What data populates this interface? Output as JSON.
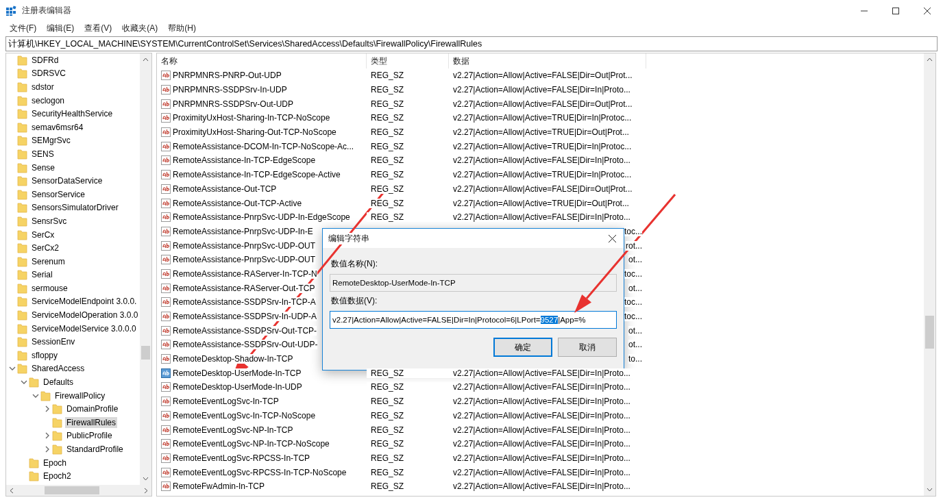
{
  "window": {
    "title": "注册表编辑器"
  },
  "menu": [
    "文件(F)",
    "编辑(E)",
    "查看(V)",
    "收藏夹(A)",
    "帮助(H)"
  ],
  "address": "计算机\\HKEY_LOCAL_MACHINE\\SYSTEM\\CurrentControlSet\\Services\\SharedAccess\\Defaults\\FirewallPolicy\\FirewallRules",
  "tree": {
    "items": [
      {
        "label": "SDFRd",
        "selected": false
      },
      {
        "label": "SDRSVC",
        "selected": false
      },
      {
        "label": "sdstor",
        "selected": false
      },
      {
        "label": "seclogon",
        "selected": false
      },
      {
        "label": "SecurityHealthService",
        "selected": false
      },
      {
        "label": "semav6msr64",
        "selected": false
      },
      {
        "label": "SEMgrSvc",
        "selected": false
      },
      {
        "label": "SENS",
        "selected": false
      },
      {
        "label": "Sense",
        "selected": false
      },
      {
        "label": "SensorDataService",
        "selected": false
      },
      {
        "label": "SensorService",
        "selected": false
      },
      {
        "label": "SensorsSimulatorDriver",
        "selected": false
      },
      {
        "label": "SensrSvc",
        "selected": false
      },
      {
        "label": "SerCx",
        "selected": false
      },
      {
        "label": "SerCx2",
        "selected": false
      },
      {
        "label": "Serenum",
        "selected": false
      },
      {
        "label": "Serial",
        "selected": false
      },
      {
        "label": "sermouse",
        "selected": false
      },
      {
        "label": "ServiceModelEndpoint 3.0.0.",
        "selected": false
      },
      {
        "label": "ServiceModelOperation 3.0.0",
        "selected": false
      },
      {
        "label": "ServiceModelService 3.0.0.0",
        "selected": false
      },
      {
        "label": "SessionEnv",
        "selected": false
      },
      {
        "label": "sfloppy",
        "selected": false
      },
      {
        "label": "SharedAccess",
        "selected": false,
        "expanded": true,
        "children": [
          {
            "label": "Defaults",
            "selected": false,
            "expanded": true,
            "children": [
              {
                "label": "FirewallPolicy",
                "selected": false,
                "expanded": true,
                "children": [
                  {
                    "label": "DomainProfile",
                    "selected": false,
                    "expanded": false
                  },
                  {
                    "label": "FirewallRules",
                    "selected": true
                  },
                  {
                    "label": "PublicProfile",
                    "selected": false,
                    "expanded": false
                  },
                  {
                    "label": "StandardProfile",
                    "selected": false,
                    "expanded": false
                  }
                ]
              }
            ]
          },
          {
            "label": "Epoch",
            "selected": false
          },
          {
            "label": "Epoch2",
            "selected": false
          }
        ]
      }
    ]
  },
  "table": {
    "columns": [
      "名称",
      "类型",
      "数据"
    ],
    "rows": [
      {
        "kind": "full",
        "name": "PNRPMNRS-PNRP-Out-UDP",
        "type": "REG_SZ",
        "data": "v2.27|Action=Allow|Active=FALSE|Dir=Out|Prot...",
        "selected": false
      },
      {
        "kind": "full",
        "name": "PNRPMNRS-SSDPSrv-In-UDP",
        "type": "REG_SZ",
        "data": "v2.27|Action=Allow|Active=FALSE|Dir=In|Proto...",
        "selected": false
      },
      {
        "kind": "full",
        "name": "PNRPMNRS-SSDPSrv-Out-UDP",
        "type": "REG_SZ",
        "data": "v2.27|Action=Allow|Active=FALSE|Dir=Out|Prot...",
        "selected": false
      },
      {
        "kind": "full",
        "name": "ProximityUxHost-Sharing-In-TCP-NoScope",
        "type": "REG_SZ",
        "data": "v2.27|Action=Allow|Active=TRUE|Dir=In|Protoc...",
        "selected": false
      },
      {
        "kind": "full",
        "name": "ProximityUxHost-Sharing-Out-TCP-NoScope",
        "type": "REG_SZ",
        "data": "v2.27|Action=Allow|Active=TRUE|Dir=Out|Prot...",
        "selected": false
      },
      {
        "kind": "full",
        "name": "RemoteAssistance-DCOM-In-TCP-NoScope-Ac...",
        "type": "REG_SZ",
        "data": "v2.27|Action=Allow|Active=TRUE|Dir=In|Protoc...",
        "selected": false
      },
      {
        "kind": "full",
        "name": "RemoteAssistance-In-TCP-EdgeScope",
        "type": "REG_SZ",
        "data": "v2.27|Action=Allow|Active=FALSE|Dir=In|Proto...",
        "selected": false
      },
      {
        "kind": "full",
        "name": "RemoteAssistance-In-TCP-EdgeScope-Active",
        "type": "REG_SZ",
        "data": "v2.27|Action=Allow|Active=TRUE|Dir=In|Protoc...",
        "selected": false
      },
      {
        "kind": "full",
        "name": "RemoteAssistance-Out-TCP",
        "type": "REG_SZ",
        "data": "v2.27|Action=Allow|Active=FALSE|Dir=Out|Prot...",
        "selected": false
      },
      {
        "kind": "full",
        "name": "RemoteAssistance-Out-TCP-Active",
        "type": "REG_SZ",
        "data": "v2.27|Action=Allow|Active=TRUE|Dir=Out|Prot...",
        "selected": false
      },
      {
        "kind": "full",
        "name": "RemoteAssistance-PnrpSvc-UDP-In-EdgeScope",
        "type": "REG_SZ",
        "data": "v2.27|Action=Allow|Active=FALSE|Dir=In|Proto...",
        "selected": false
      },
      {
        "kind": "partial",
        "name": "RemoteAssistance-PnrpSvc-UDP-In-E",
        "data": "toc...",
        "selected": false
      },
      {
        "kind": "partial",
        "name": "RemoteAssistance-PnrpSvc-UDP-OUT",
        "data": "rot...",
        "selected": false
      },
      {
        "kind": "partial",
        "name": "RemoteAssistance-PnrpSvc-UDP-OUT",
        "data": "ot...",
        "selected": false
      },
      {
        "kind": "partial",
        "name": "RemoteAssistance-RAServer-In-TCP-N",
        "data": "toc...",
        "selected": false
      },
      {
        "kind": "partial",
        "name": "RemoteAssistance-RAServer-Out-TCP",
        "data": "ot...",
        "selected": false
      },
      {
        "kind": "partial",
        "name": "RemoteAssistance-SSDPSrv-In-TCP-A",
        "data": "toc...",
        "selected": false
      },
      {
        "kind": "partial",
        "name": "RemoteAssistance-SSDPSrv-In-UDP-A",
        "data": "toc...",
        "selected": false
      },
      {
        "kind": "partial",
        "name": "RemoteAssistance-SSDPSrv-Out-TCP-",
        "data": "ot...",
        "selected": false
      },
      {
        "kind": "partial",
        "name": "RemoteAssistance-SSDPSrv-Out-UDP-",
        "data": "ot...",
        "selected": false
      },
      {
        "kind": "partial",
        "name": "RemoteDesktop-Shadow-In-TCP",
        "data": "to...",
        "selected": false
      },
      {
        "kind": "full",
        "name": "RemoteDesktop-UserMode-In-TCP",
        "type": "REG_SZ",
        "data": "v2.27|Action=Allow|Active=FALSE|Dir=In|Proto...",
        "selected": true
      },
      {
        "kind": "full",
        "name": "RemoteDesktop-UserMode-In-UDP",
        "type": "REG_SZ",
        "data": "v2.27|Action=Allow|Active=FALSE|Dir=In|Proto...",
        "selected": false
      },
      {
        "kind": "full",
        "name": "RemoteEventLogSvc-In-TCP",
        "type": "REG_SZ",
        "data": "v2.27|Action=Allow|Active=FALSE|Dir=In|Proto...",
        "selected": false
      },
      {
        "kind": "full",
        "name": "RemoteEventLogSvc-In-TCP-NoScope",
        "type": "REG_SZ",
        "data": "v2.27|Action=Allow|Active=FALSE|Dir=In|Proto...",
        "selected": false
      },
      {
        "kind": "full",
        "name": "RemoteEventLogSvc-NP-In-TCP",
        "type": "REG_SZ",
        "data": "v2.27|Action=Allow|Active=FALSE|Dir=In|Proto...",
        "selected": false
      },
      {
        "kind": "full",
        "name": "RemoteEventLogSvc-NP-In-TCP-NoScope",
        "type": "REG_SZ",
        "data": "v2.27|Action=Allow|Active=FALSE|Dir=In|Proto...",
        "selected": false
      },
      {
        "kind": "full",
        "name": "RemoteEventLogSvc-RPCSS-In-TCP",
        "type": "REG_SZ",
        "data": "v2.27|Action=Allow|Active=FALSE|Dir=In|Proto...",
        "selected": false
      },
      {
        "kind": "full",
        "name": "RemoteEventLogSvc-RPCSS-In-TCP-NoScope",
        "type": "REG_SZ",
        "data": "v2.27|Action=Allow|Active=FALSE|Dir=In|Proto...",
        "selected": false
      },
      {
        "kind": "full",
        "name": "RemoteFwAdmin-In-TCP",
        "type": "REG_SZ",
        "data": "v2.27|Action=Allow|Active=FALSE|Dir=In|Proto...",
        "selected": false
      }
    ]
  },
  "dialog": {
    "title": "编辑字符串",
    "fields": [
      {
        "label": "数值名称(N):",
        "value": "RemoteDesktop-UserMode-In-TCP",
        "disabled": true
      },
      {
        "label": "数值数据(V):",
        "value": "v2.27|Action=Allow|Active=FALSE|Dir=In|Protocol=6|LPort=",
        "selected_text": "9527",
        "value_rest": "|App=%",
        "disabled": false
      }
    ],
    "buttons": [
      {
        "label": "确定",
        "default": true
      },
      {
        "label": "取消",
        "default": false
      }
    ]
  }
}
